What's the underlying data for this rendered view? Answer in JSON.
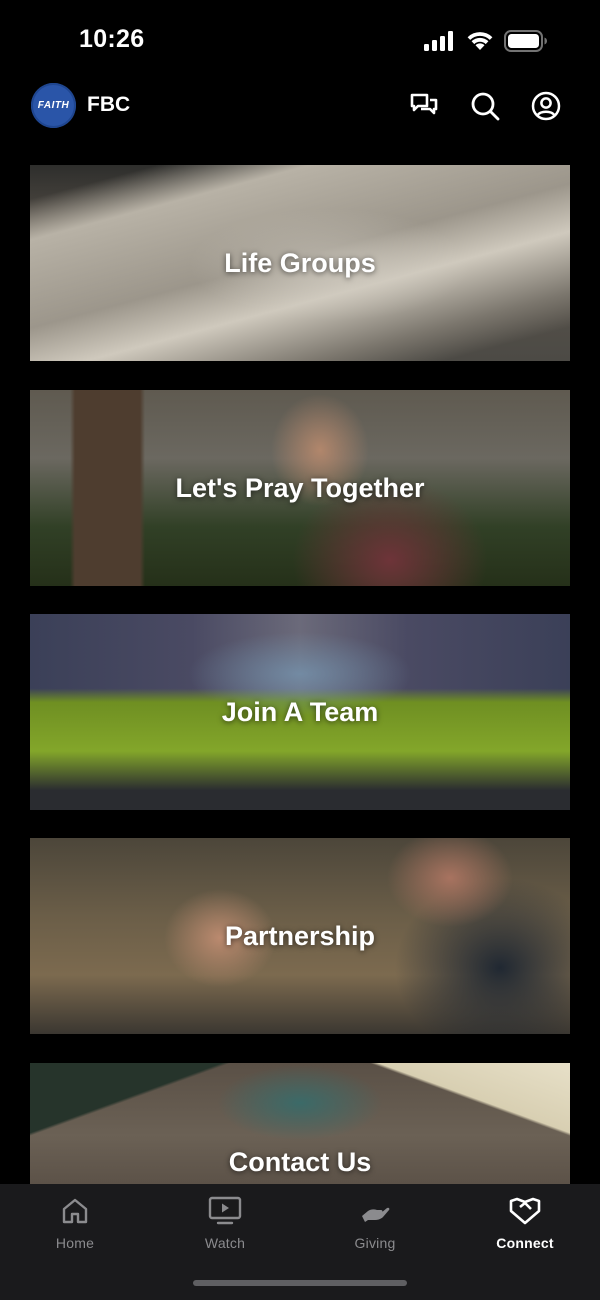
{
  "status_bar": {
    "time": "10:26"
  },
  "header": {
    "logo_text": "FAITH",
    "title": "FBC"
  },
  "cards": [
    {
      "label": "Life Groups"
    },
    {
      "label": "Let's Pray Together"
    },
    {
      "label": "Join A Team"
    },
    {
      "label": "Partnership"
    },
    {
      "label": "Contact Us"
    }
  ],
  "tabs": [
    {
      "label": "Home"
    },
    {
      "label": "Watch"
    },
    {
      "label": "Giving"
    },
    {
      "label": "Connect"
    }
  ],
  "colors": {
    "background": "#000000",
    "tab_bar": "#1a1a1c",
    "logo_blue": "#2a55a8",
    "inactive_tab": "#8b8b8e"
  }
}
